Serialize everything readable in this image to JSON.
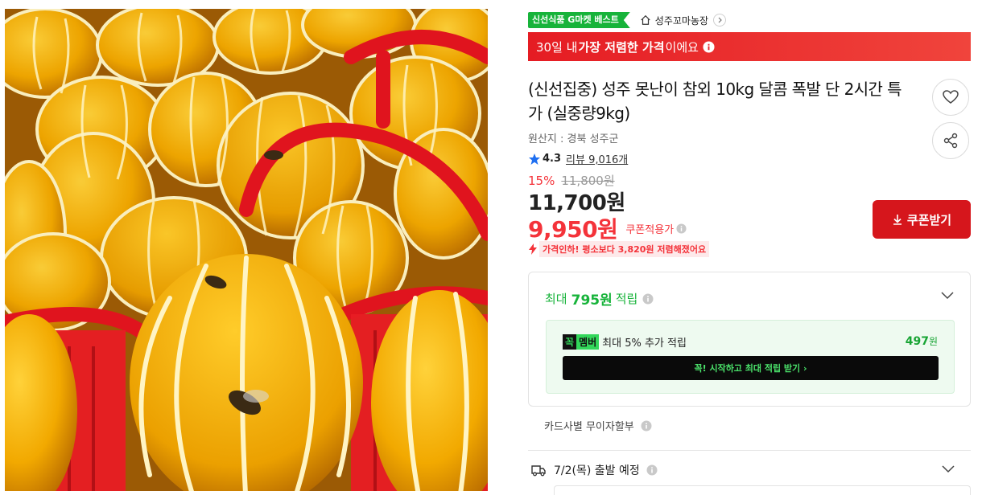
{
  "photo": {
    "alt": "성주 참외와 빨간 바구니"
  },
  "badges": {
    "fresh": "신선식품 G마켓 베스트"
  },
  "store": {
    "name": "성주꼬마농장"
  },
  "banner": {
    "prefix": "30일 내 ",
    "bold": "가장 저렴한 가격",
    "suffix": "이에요"
  },
  "product": {
    "title": "(신선집중) 성주 못난이 참외 10kg 달콤 폭발 단 2시간 특가 (실중량9kg)",
    "origin": "원산지 : 경북 성주군",
    "rating": "4.3",
    "reviews": "리뷰 9,016개"
  },
  "price": {
    "discount_rate": "15%",
    "original": "11,800원",
    "sale": "11,700원",
    "coupon": "9,950원",
    "coupon_note": "쿠폰적용가",
    "drop_note": "가격인하! 평소보다 3,820원 저렴해졌어요"
  },
  "actions": {
    "coupon_button": "쿠폰받기"
  },
  "reward": {
    "prefix": "최대",
    "amount": "795원",
    "suffix": "적립",
    "member_logo_a": "꼭",
    "member_logo_b": "멤버",
    "member_text": "최대 5% 추가 적립",
    "member_amount": "497",
    "member_unit": "원",
    "member_button": "꼭! 시작하고 최대 적립 받기  ›"
  },
  "card": {
    "label": "카드사별 무이자할부"
  },
  "shipping": {
    "label": "7/2(목) 출발 예정"
  },
  "colors": {
    "accent_red": "#f4333a",
    "button_red": "#d6161c",
    "green": "#17b33a"
  }
}
